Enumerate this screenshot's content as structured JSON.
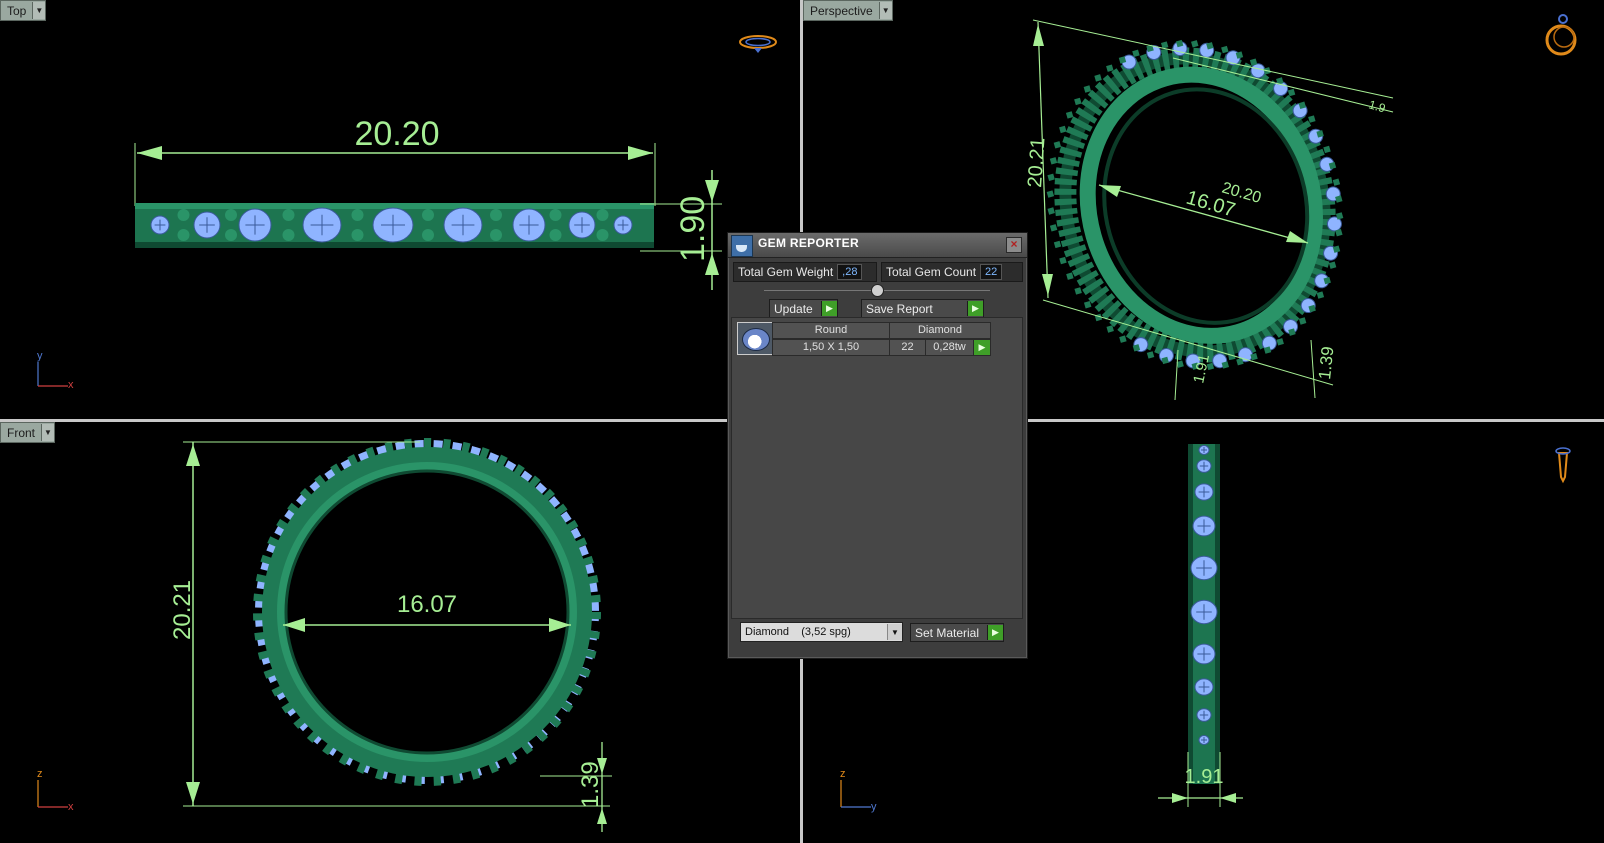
{
  "viewports": {
    "top": {
      "label": "Top",
      "width_dim": "20.20",
      "height_dim": "1.90"
    },
    "perspective": {
      "label": "Perspective",
      "dim_outer": "20.21",
      "dim_inner": "16.07",
      "dim_width": "20.20",
      "dim_small_a": "1.91",
      "dim_small_b": "1.39",
      "dim_small_c": "1.9"
    },
    "front": {
      "label": "Front",
      "height_dim": "20.21",
      "inner_dim": "16.07",
      "small_dim": "1.39"
    },
    "right": {
      "width_dim": "1.91"
    }
  },
  "axes": {
    "top": {
      "v": "y",
      "h": "x"
    },
    "front": {
      "v": "z",
      "h": "x"
    },
    "right": {
      "v": "z",
      "h": "y"
    }
  },
  "gem_reporter": {
    "title": "GEM REPORTER",
    "close_label": "×",
    "total_weight_label": "Total Gem Weight",
    "total_weight_value": ",28",
    "total_count_label": "Total Gem Count",
    "total_count_value": "22",
    "update_label": "Update",
    "save_report_label": "Save Report",
    "go_glyph": "▶",
    "columns": {
      "shape": "Round",
      "material": "Diamond"
    },
    "gems": [
      {
        "size": "1,50 X 1,50",
        "count": "22",
        "weight": "0,28tw"
      }
    ],
    "material_select": {
      "value": "Diamond    (3,52 spg)"
    },
    "set_material_label": "Set Material"
  },
  "colors": {
    "dimension": "#a6ee94",
    "ring_band": "#1f7a55",
    "ring_dark": "#0f4a32",
    "gem": "#8fb4ff",
    "axis_x": "#d04040",
    "axis_y": "#4f78d0"
  }
}
